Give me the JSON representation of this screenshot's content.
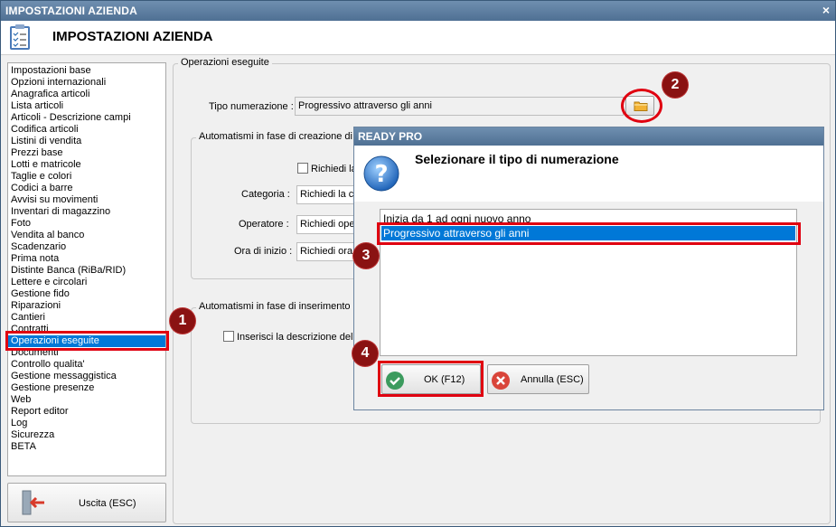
{
  "window": {
    "title": "IMPOSTAZIONI AZIENDA",
    "close_glyph": "×"
  },
  "header": {
    "title": "IMPOSTAZIONI AZIENDA",
    "icon": "checklist-icon"
  },
  "sidebar": {
    "items": [
      "Impostazioni base",
      "Opzioni internazionali",
      "Anagrafica articoli",
      "Lista articoli",
      "Articoli - Descrizione campi",
      "Codifica articoli",
      "Listini di vendita",
      "Prezzi base",
      "Lotti e matricole",
      "Taglie e colori",
      "Codici a barre",
      "Avvisi su movimenti",
      "Inventari di magazzino",
      "Foto",
      "Vendita al banco",
      "Scadenzario",
      "Prima nota",
      "Distinte Banca (RiBa/RID)",
      "Lettere e circolari",
      "Gestione fido",
      "Riparazioni",
      "Cantieri",
      "Contratti",
      "Operazioni eseguite",
      "Documenti",
      "Controllo qualita'",
      "Gestione messaggistica",
      "Gestione presenze",
      "Web",
      "Report editor",
      "Log",
      "Sicurezza",
      "BETA"
    ],
    "selected": "Operazioni eseguite",
    "exit_label": "Uscita (ESC)"
  },
  "main": {
    "group_title": "Operazioni eseguite",
    "tipo_label": "Tipo numerazione :",
    "tipo_value": "Progressivo attraverso gli anni",
    "automatismi_creazione": {
      "legend": "Automatismi in fase di creazione di u",
      "checkbox_label": "Richiedi la",
      "categoria_label": "Categoria :",
      "categoria_value": "Richiedi la ca",
      "operatore_label": "Operatore :",
      "operatore_value": "Richiedi oper",
      "ora_label": "Ora di inizio :",
      "ora_value": "Richiedi ora"
    },
    "automatismi_inserimento": {
      "legend": "Automatismi in fase di inserimento d",
      "checkbox_label": "Inserisci la descrizione dell'"
    }
  },
  "dialog": {
    "title": "READY PRO",
    "message": "Selezionare il tipo di numerazione",
    "options": [
      "Inizia da 1 ad ogni nuovo anno",
      "Progressivo attraverso gli anni"
    ],
    "selected_index": 1,
    "ok_label": "OK (F12)",
    "cancel_label": "Annulla (ESC)"
  },
  "markers": [
    "1",
    "2",
    "3",
    "4"
  ],
  "colors": {
    "highlight": "#e00010",
    "marker": "#8a1212",
    "selection": "#0078d7",
    "titlebar": "#5b7ea3"
  }
}
